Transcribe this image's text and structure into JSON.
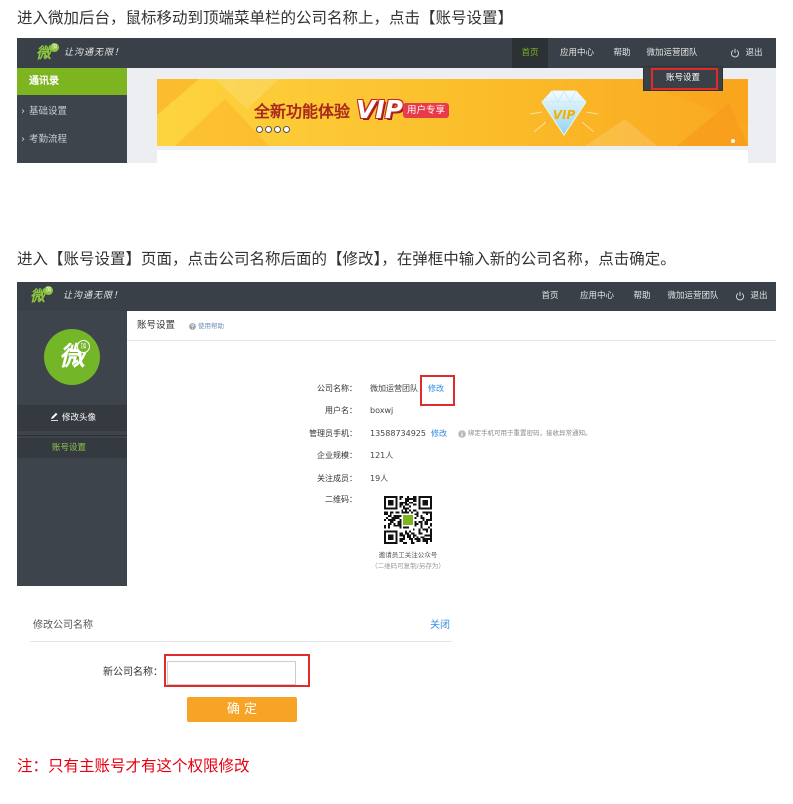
{
  "doc": {
    "step1": "进入微加后台，鼠标移动到顶端菜单栏的公司名称上，点击【账号设置】",
    "step2": "进入【账号设置】页面，点击公司名称后面的【修改】，在弹框中输入新的公司名称，点击确定。",
    "note": "注：只有主账号才有这个权限修改"
  },
  "brand": {
    "logo_glyph": "微",
    "logo_badge": "加",
    "slogan": "让沟通无限！"
  },
  "icons": {
    "logo": "logo-icon",
    "logout": "power-icon",
    "sidebar_bullet": "›",
    "edit_avatar": "pencil-icon",
    "help": "help-circle-icon",
    "hint": "info-icon",
    "qr": "qr-code-image",
    "banner_badge": "diamond-icon"
  },
  "colors": {
    "nav_bg": "#3a4047",
    "sidebar_bg": "#3e444b",
    "brand_green": "#7cb51f",
    "highlight_red": "#e02b2b",
    "link_blue": "#2c8be0",
    "confirm_orange": "#f7a325",
    "note_red": "#e60012",
    "banner_orange": "#fbbd2a"
  },
  "screen1": {
    "nav": {
      "items": [
        "首页",
        "应用中心",
        "帮助",
        "微加运营团队"
      ],
      "active_index": 0,
      "logout": "退出"
    },
    "dropdown": {
      "items": [
        "账号设置"
      ]
    },
    "sidebar": {
      "header": "通讯录",
      "items": [
        "基础设置",
        "考勤流程"
      ]
    },
    "banner": {
      "headline": "全新功能体验",
      "vip": "VIP",
      "vip_tag": "用户专享",
      "badge_label": "VIP",
      "slides": 4
    }
  },
  "screen2": {
    "nav": {
      "items": [
        "首页",
        "应用中心",
        "帮助",
        "微加运营团队"
      ],
      "logout": "退出"
    },
    "sidebar": {
      "edit_avatar": "修改头像",
      "items": [
        "账号设置"
      ],
      "active_index": 0
    },
    "page": {
      "title": "账号设置",
      "help": "使用帮助"
    },
    "fields": [
      {
        "label": "公司名称：",
        "value": "微加运营团队",
        "action": "修改"
      },
      {
        "label": "用户名：",
        "value": "boxwj"
      },
      {
        "label": "管理员手机：",
        "value": "13588734925",
        "action": "修改",
        "hint": "绑定手机可用于重置密码，接收异常通知。"
      },
      {
        "label": "企业规模：",
        "value": "121人"
      },
      {
        "label": "关注成员：",
        "value": "19人"
      },
      {
        "label": "二维码："
      }
    ],
    "qr": {
      "caption": "邀请员工关注公众号",
      "note": "（二维码可复制/另存为）"
    }
  },
  "dialog": {
    "title": "修改公司名称",
    "close": "关闭",
    "field_label": "新公司名称：",
    "confirm": "确 定"
  }
}
